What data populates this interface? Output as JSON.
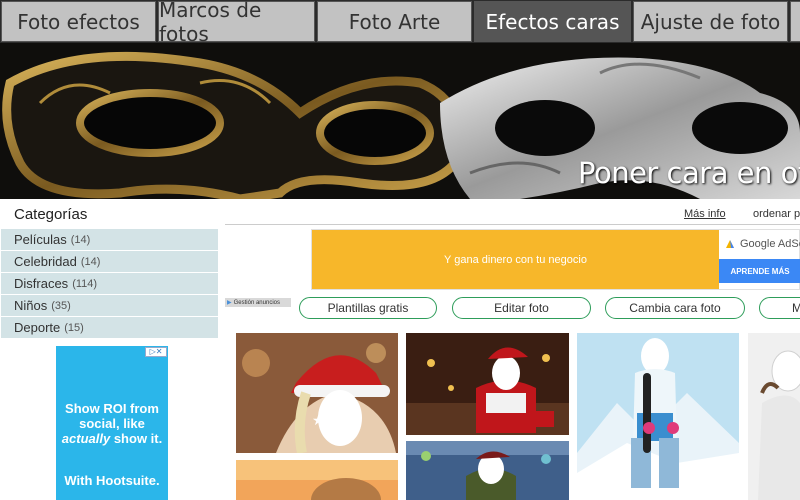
{
  "tabs": [
    {
      "label": "Foto efectos",
      "active": false
    },
    {
      "label": "Marcos de fotos",
      "active": false
    },
    {
      "label": "Foto Arte",
      "active": false
    },
    {
      "label": "Efectos caras",
      "active": true
    },
    {
      "label": "Ajuste de foto",
      "active": false
    }
  ],
  "banner": {
    "title": "Poner cara en otro c"
  },
  "sidebar": {
    "title": "Categorías",
    "items": [
      {
        "label": "Películas",
        "count": "(14)"
      },
      {
        "label": "Celebridad",
        "count": "(14)"
      },
      {
        "label": "Disfraces",
        "count": "(114)"
      },
      {
        "label": "Niños",
        "count": "(35)"
      },
      {
        "label": "Deporte",
        "count": "(15)"
      }
    ],
    "ad": {
      "line1": "Show ROI from social, like",
      "em": "actually",
      "line1b": "show it.",
      "line2": "With Hootsuite."
    }
  },
  "header_links": {
    "more_info": "Más info",
    "sort": "ordenar p"
  },
  "ad_banner": {
    "text": "Y gana dinero con tu negocio",
    "brand": "Google AdSen",
    "button": "APRENDE MÁS"
  },
  "ad_manage": "Gestión anuncios",
  "pills": [
    "Plantillas gratis",
    "Editar foto",
    "Cambia cara foto",
    "M"
  ],
  "photos": [
    {
      "name": "santa-hat-girl"
    },
    {
      "name": "santa-christmas-room"
    },
    {
      "name": "snowboard-girl"
    },
    {
      "name": "sunset-kid"
    },
    {
      "name": "soldier-helicopter"
    },
    {
      "name": "wedding-dress"
    }
  ],
  "colors": {
    "accent_green": "#2e9d5a",
    "sidebar_bg": "#d3e3e6",
    "ad_yellow": "#f7b72a",
    "ad_blue": "#3b88f5",
    "social_ad": "#2bb6ea"
  }
}
